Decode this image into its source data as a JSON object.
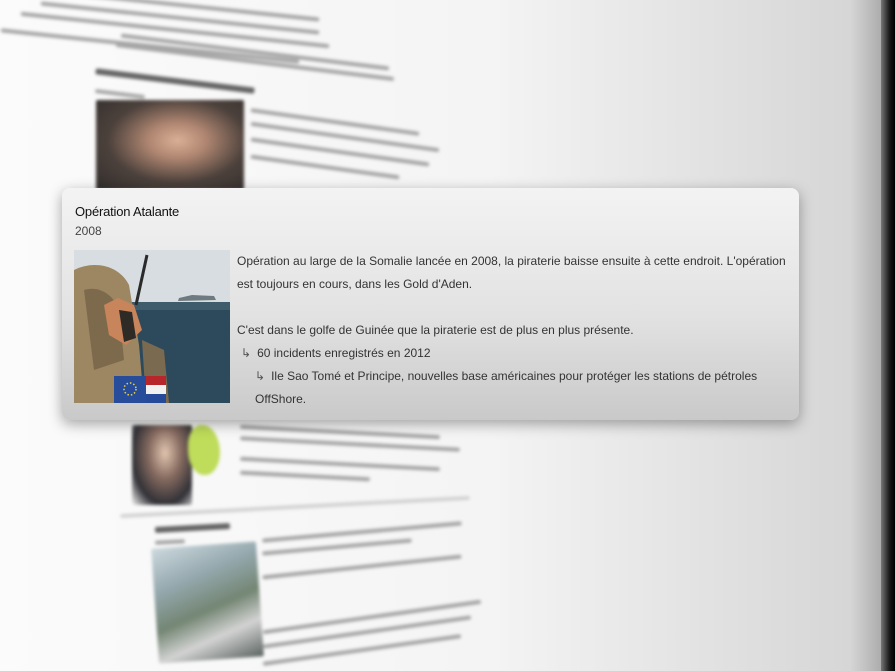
{
  "card": {
    "title": "Opération Atalante",
    "year": "2008",
    "paragraph1": "Opération au large de la Somalie lancée en 2008, la piraterie baisse ensuite à cette endroit. L'opération est toujours en cours, dans les Gold d'Aden.",
    "paragraph2": "C'est dans le golfe de Guinée que la piraterie est de plus en plus présente.",
    "sub_items": [
      {
        "arrow": "↳",
        "text": "60 incidents enregistrés en 2012"
      },
      {
        "arrow": "↳",
        "text": "Ile Sao Tomé et Principe, nouvelles base américaines pour protéger les stations de pétroles OffShore."
      }
    ],
    "photo_icon": "soldier-on-ship-photo"
  },
  "background": {
    "photos": [
      "portrait-photo",
      "africa-map-photo",
      "ship-deck-photo"
    ]
  }
}
